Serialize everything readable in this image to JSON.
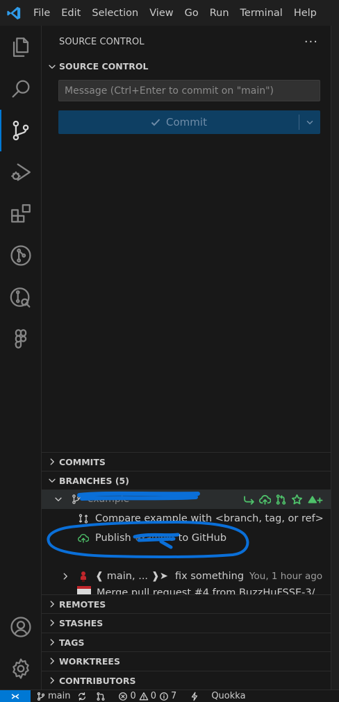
{
  "menu": [
    "File",
    "Edit",
    "Selection",
    "View",
    "Go",
    "Run",
    "Terminal",
    "Help"
  ],
  "activity_bar": [
    "files-icon",
    "search-icon",
    "source-control-icon",
    "run-debug-icon",
    "extensions-icon",
    "git-graph-icon",
    "gitlens-inspect-icon",
    "figma-icon",
    "accounts-icon",
    "settings-gear-icon"
  ],
  "sidebar": {
    "title": "SOURCE CONTROL",
    "more_actions": "···",
    "sections": {
      "source_control": "SOURCE CONTROL",
      "commits": "COMMITS",
      "branches": "BRANCHES (5)",
      "remotes": "REMOTES",
      "stashes": "STASHES",
      "tags": "TAGS",
      "worktrees": "WORKTREES",
      "contributors": "CONTRIBUTORS"
    }
  },
  "commit": {
    "placeholder": "Message (Ctrl+Enter to commit on \"main\")",
    "button_label": "Commit"
  },
  "branches": {
    "current_branch_redacted": "example",
    "compare_label": "Compare example with <branch, tag, or ref>",
    "publish_prefix": "Publish",
    "publish_branch_redacted": "example",
    "publish_suffix": "to GitHub",
    "main_branch_label": "❰ main, ... ❱➤",
    "main_commit_message": "fix something",
    "main_commit_meta": "You, 1 hour ago",
    "partial_row_text": "Merge pull request #4 from BuzzHuFSSE-3/"
  },
  "status": {
    "branch": "main",
    "errors": "0",
    "warnings": "0",
    "info": "7",
    "extension": "Quokka"
  },
  "colors": {
    "accent": "#0078d4",
    "commit_button": "#0e3f63",
    "action_green": "#4ec16a",
    "annotation_blue": "#0a6fd8"
  }
}
